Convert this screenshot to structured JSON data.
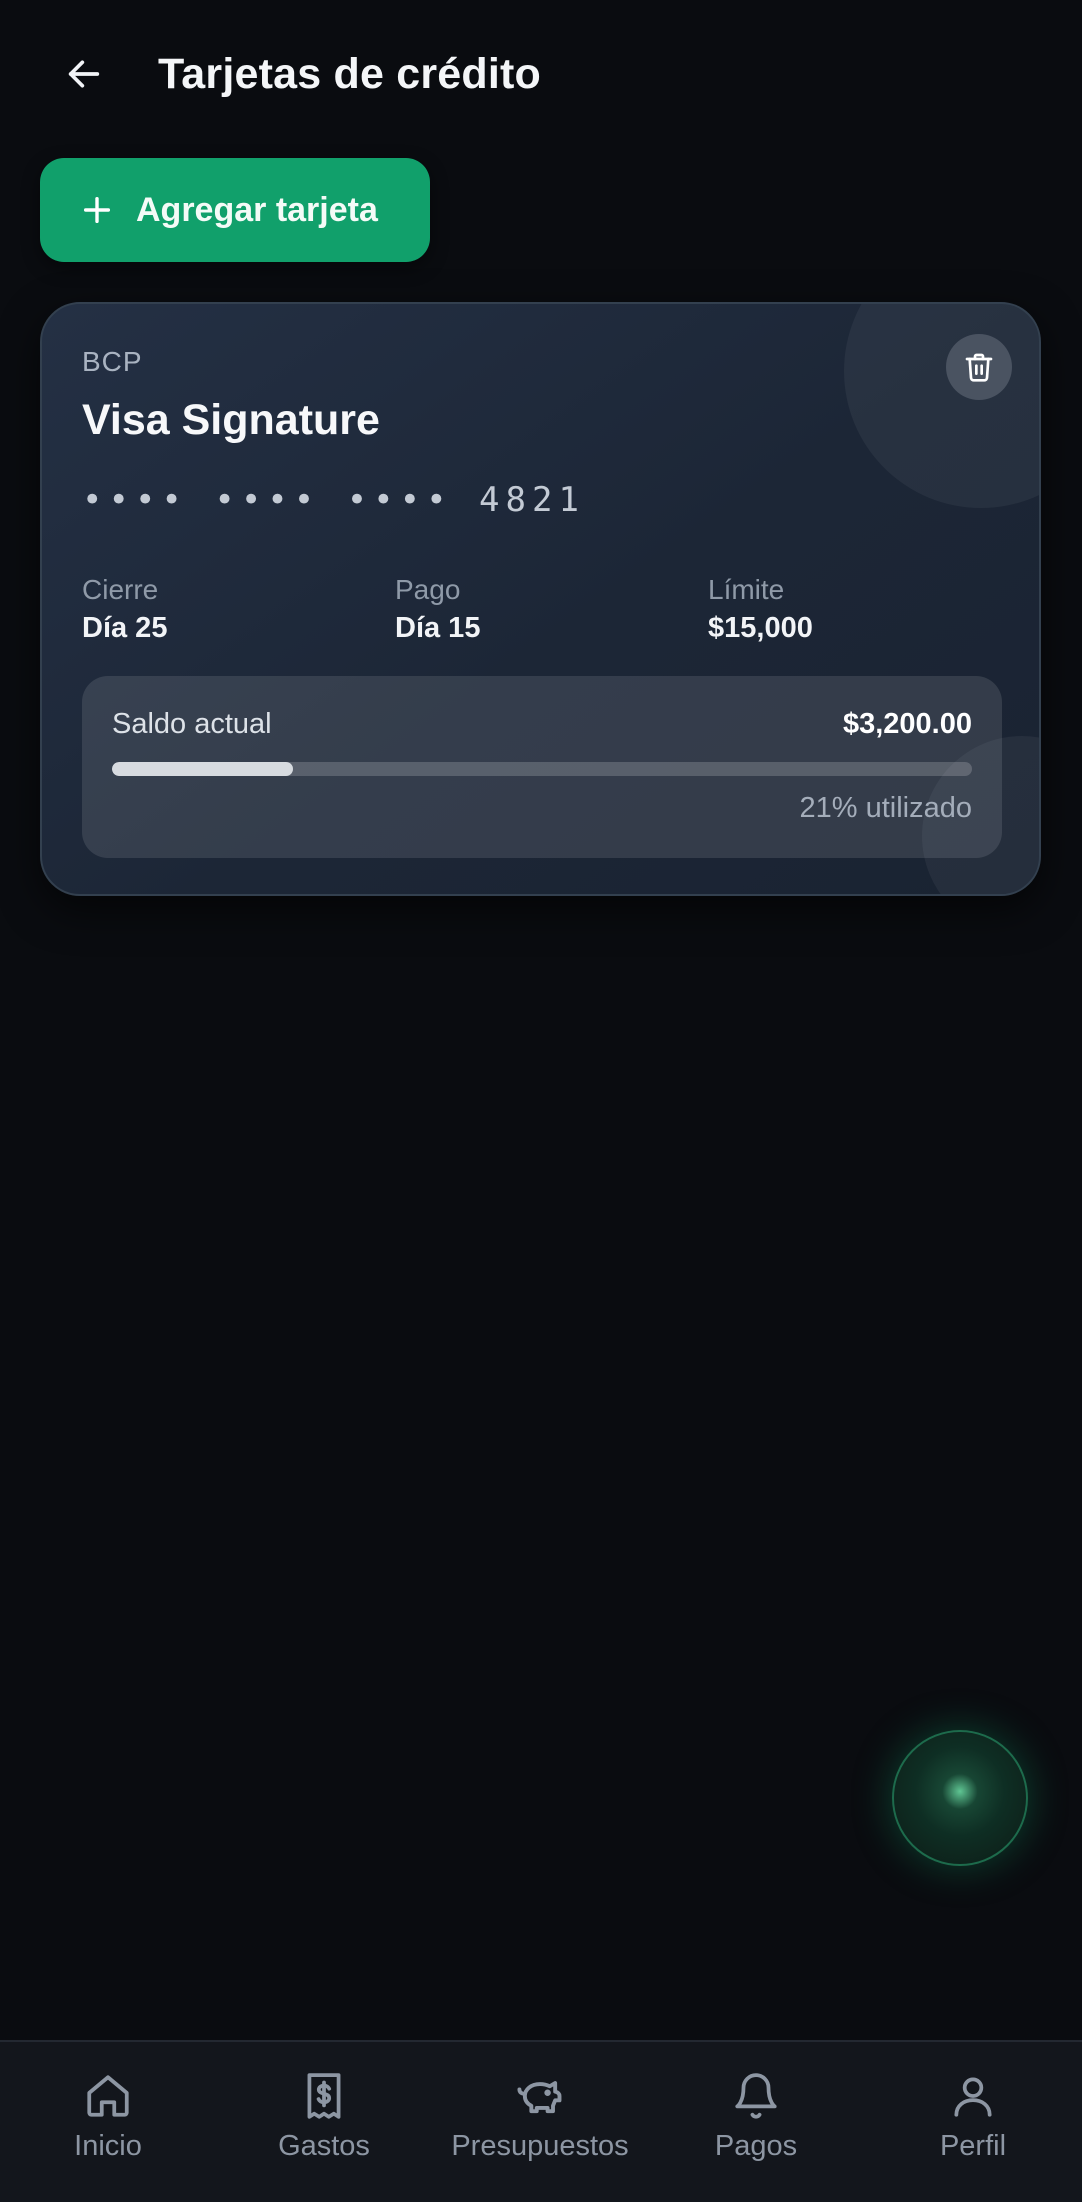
{
  "header": {
    "title": "Tarjetas de crédito",
    "back_icon": "arrow-left-icon"
  },
  "add_button": {
    "label": "Agregar tarjeta",
    "icon": "plus-icon",
    "color": "#11a06b"
  },
  "card": {
    "bank": "BCP",
    "name": "Visa Signature",
    "number_masked": "•••• •••• •••• 4821",
    "delete_icon": "trash-icon",
    "closing": {
      "label": "Cierre",
      "value": "Día 25"
    },
    "payment": {
      "label": "Pago",
      "value": "Día 15"
    },
    "limit": {
      "label": "Límite",
      "value": "$15,000"
    },
    "balance": {
      "label": "Saldo actual",
      "amount": "$3,200.00",
      "utilization_percent": 21,
      "utilization_text": "21% utilizado"
    }
  },
  "bottom_nav": {
    "items": [
      {
        "label": "Inicio",
        "icon": "home-icon"
      },
      {
        "label": "Gastos",
        "icon": "receipt-icon"
      },
      {
        "label": "Presupuestos",
        "icon": "piggy-bank-icon"
      },
      {
        "label": "Pagos",
        "icon": "bell-icon"
      },
      {
        "label": "Perfil",
        "icon": "user-icon"
      }
    ]
  },
  "colors": {
    "background": "#0a0c10",
    "accent": "#11a06b",
    "card": "#1f2a3b"
  }
}
